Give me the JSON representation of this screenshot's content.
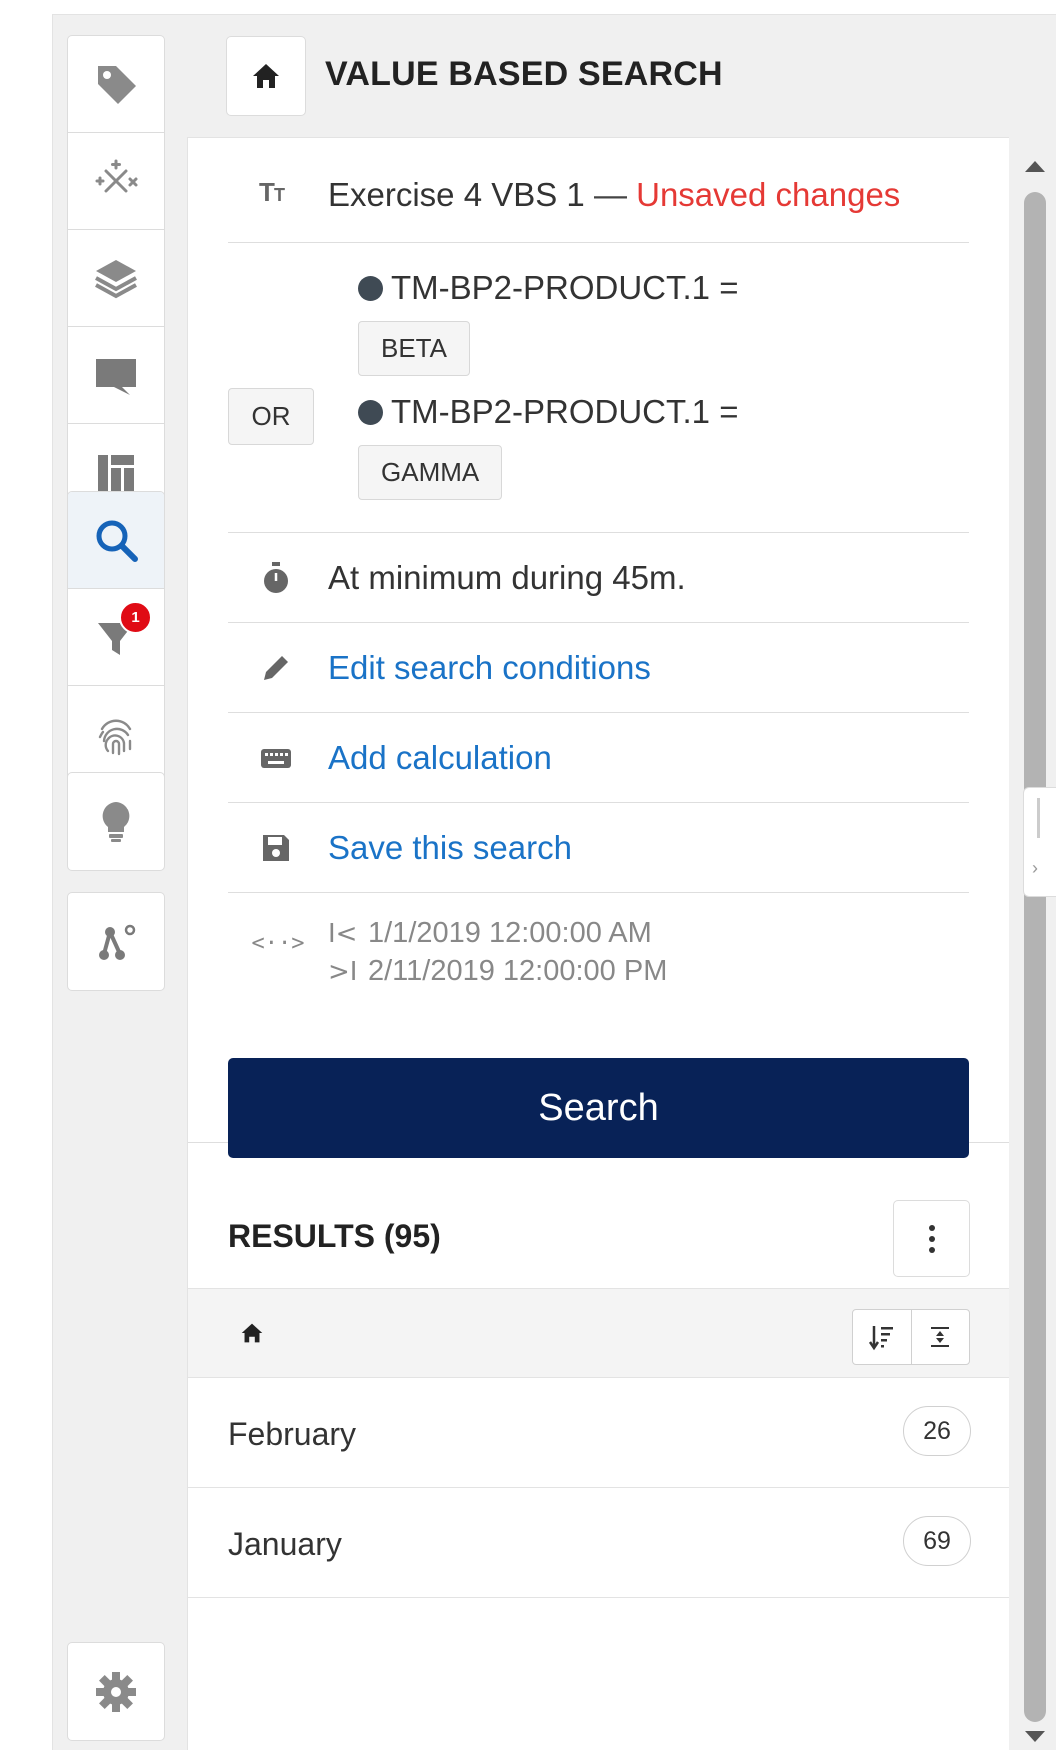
{
  "header": {
    "title": "VALUE BASED SEARCH",
    "home_icon": "home-icon"
  },
  "rail": {
    "groups": [
      {
        "items": [
          "tag-icon",
          "sparkle-icon",
          "layers-icon",
          "comment-icon",
          "dashboard-icon"
        ]
      },
      {
        "items": [
          "search-icon",
          "filter-icon",
          "fingerprint-icon"
        ],
        "active": "search-icon",
        "filter_badge": "1"
      },
      {
        "items": [
          "lightbulb-icon"
        ]
      },
      {
        "items": [
          "pattern-icon"
        ]
      },
      {
        "items": [
          "settings-icon"
        ]
      }
    ]
  },
  "search": {
    "name": "Exercise 4 VBS 1",
    "separator": "—",
    "status": "Unsaved changes",
    "conditions": [
      {
        "tag": "TM-BP2-PRODUCT.1 =",
        "value": "BETA"
      },
      {
        "operator": "OR",
        "tag": "TM-BP2-PRODUCT.1 =",
        "value": "GAMMA"
      }
    ],
    "duration": "At minimum during 45m.",
    "actions": {
      "edit": "Edit search conditions",
      "calc": "Add calculation",
      "save": "Save this search"
    },
    "time_range": {
      "range_icon": "<··>",
      "start_marker": "I<",
      "start": "1/1/2019 12:00:00 AM",
      "end_marker": ">I",
      "end": "2/11/2019 12:00:00 PM"
    },
    "button": "Search"
  },
  "results": {
    "title": "RESULTS (95)",
    "rows": [
      {
        "name": "February",
        "count": "26"
      },
      {
        "name": "January",
        "count": "69"
      }
    ]
  },
  "colors": {
    "accent": "#082257",
    "link": "#1a73c7",
    "warning": "#e53935",
    "badge": "#e00b15"
  }
}
